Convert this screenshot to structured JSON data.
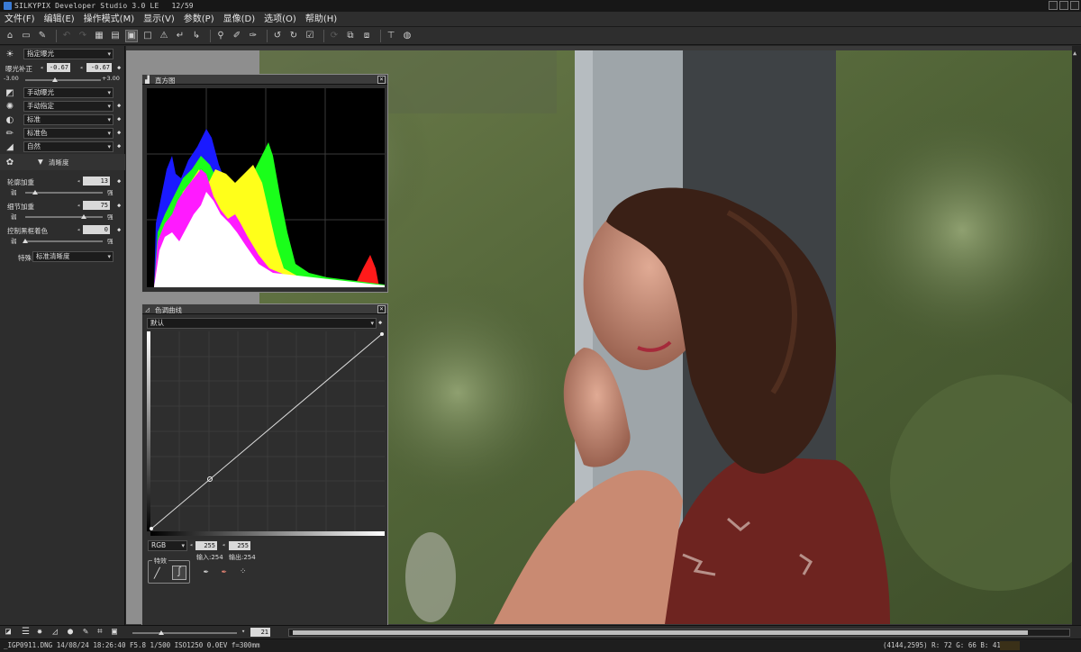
{
  "window": {
    "title": "SILKYPIX Developer Studio 3.0 LE",
    "counter": "12/59"
  },
  "menu": [
    "文件(F)",
    "编辑(E)",
    "操作模式(M)",
    "显示(V)",
    "参数(P)",
    "显像(D)",
    "选项(O)",
    "帮助(H)"
  ],
  "toolbar": {
    "icons": [
      "open-folder-icon",
      "open-file-icon",
      "develop-icon",
      "undo-icon",
      "redo-icon",
      "grid-view-icon",
      "filmstrip-view-icon",
      "single-view-icon",
      "full-view-icon",
      "warning-icon",
      "rotate-left-icon",
      "rotate-right-icon",
      "zoom-icon",
      "white-balance-picker-icon",
      "gray-balance-icon",
      "rotate-ccw-icon",
      "rotate-cw-icon",
      "check-icon",
      "sync-icon",
      "copy-params-icon",
      "paste-params-icon",
      "crop-icon",
      "color-settings-icon"
    ]
  },
  "left": {
    "exposure_mode": "指定曝光",
    "exposure_label": "曝光补正",
    "exposure_value": "-0.67",
    "exposure_value2": "-0.67",
    "range_min": "-3.00",
    "range_max": "+3.00",
    "exposure_slider_pct": 0.39,
    "tone": "手动曝光",
    "wb": "手动指定",
    "contrast": "标准",
    "color": "标准色",
    "taste": "自然",
    "section": "清晰度",
    "clarity": {
      "label": "轮廓加重",
      "value": "13",
      "low": "弱",
      "high": "强",
      "pct": 0.13
    },
    "detail": {
      "label": "细节加重",
      "value": "75",
      "low": "弱",
      "high": "强",
      "pct": 0.75
    },
    "halo": {
      "label": "控制黑框着色",
      "value": "0",
      "low": "弱",
      "high": "强",
      "pct": 0.0
    },
    "special_label": "特殊",
    "special_value": "标准清晰度"
  },
  "histogram": {
    "title": "直方图"
  },
  "curve": {
    "title": "色调曲线",
    "preset": "默认",
    "channel": "RGB",
    "in_value": "255",
    "out_value": "255",
    "in_label": "输入:254",
    "out_label": "输出:254",
    "special_label": "特效"
  },
  "bottom": {
    "zoom_value": "21"
  },
  "status": {
    "left": "_IGP0911.DNG 14/08/24 18:26:40 F5.8 1/500 ISO1250 0.0EV f=300mm",
    "right": "(4144,2595) R: 72 G: 66 B: 41"
  },
  "colors": {
    "accent": "#d8d8d8",
    "panel": "#2d2d2d"
  }
}
